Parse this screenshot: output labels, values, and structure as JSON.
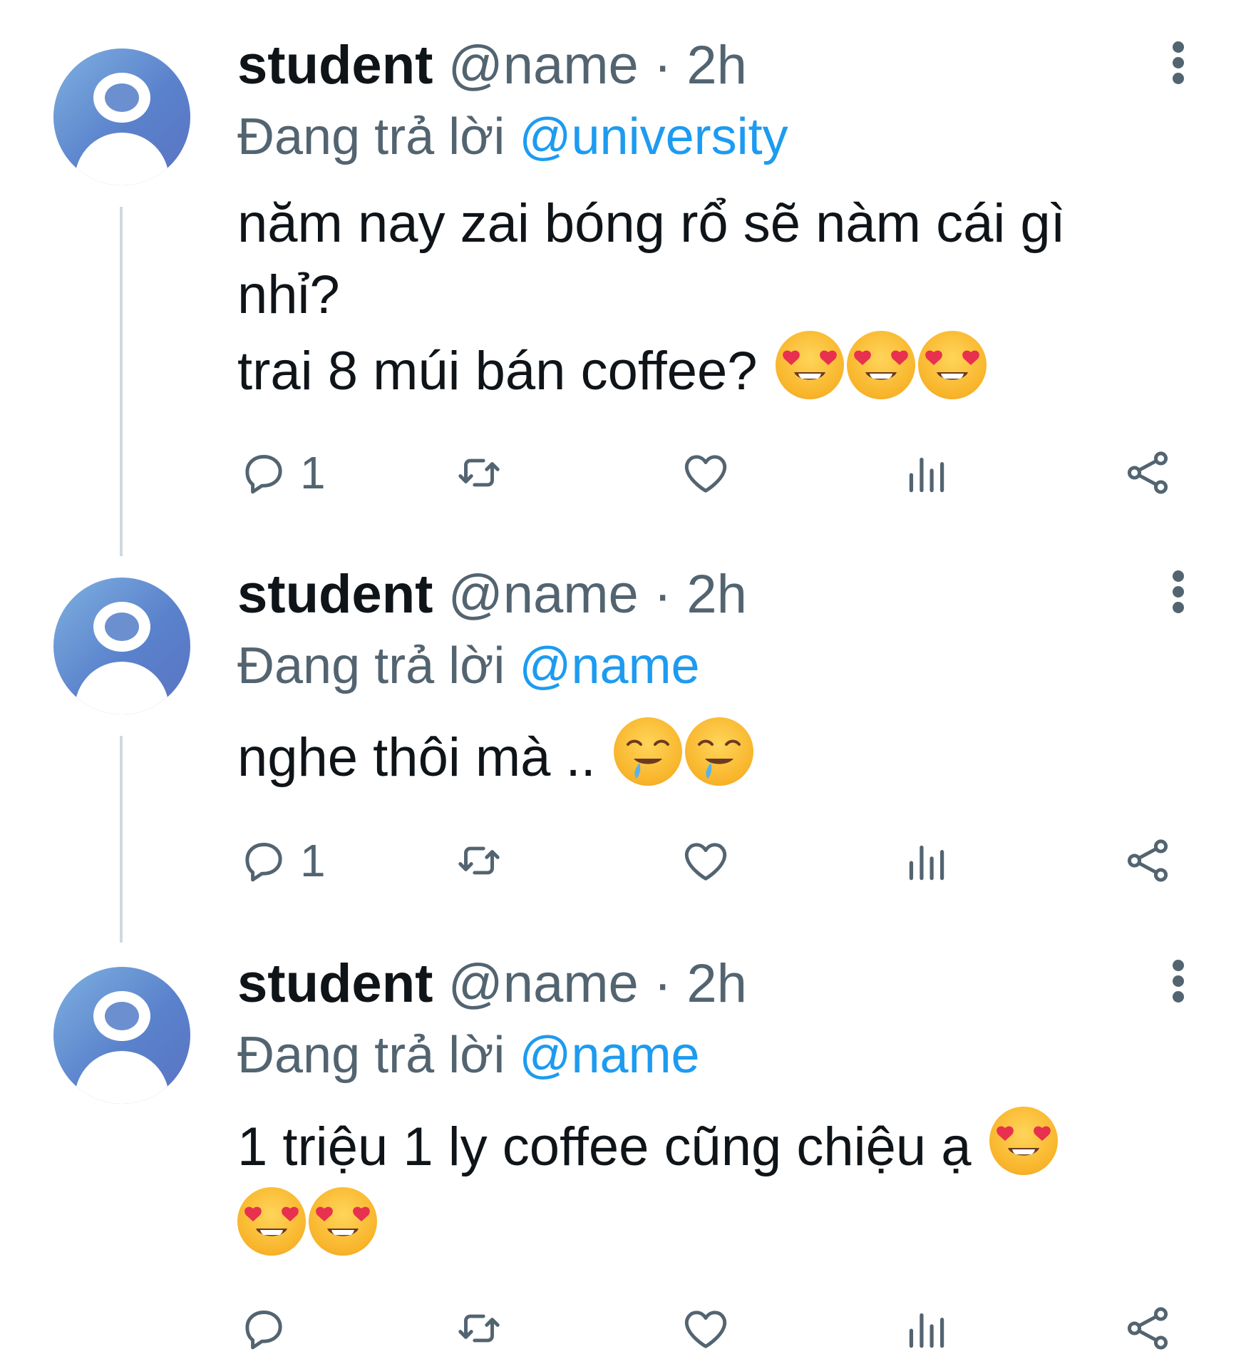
{
  "tweets": [
    {
      "display_name": "student",
      "handle": "@name",
      "separator": "·",
      "time": "2h",
      "reply_prefix": "Đang trả lời",
      "reply_to": "@university",
      "text_lines": [
        "năm nay zai bóng rổ sẽ nàm cái gì",
        "nhỉ?",
        "trai 8 múi bán coffee?"
      ],
      "trailing_emojis": [
        "heart-eyes",
        "heart-eyes",
        "heart-eyes"
      ],
      "reply_count": "1"
    },
    {
      "display_name": "student",
      "handle": "@name",
      "separator": "·",
      "time": "2h",
      "reply_prefix": "Đang trả lời",
      "reply_to": "@name",
      "text_lines": [
        "nghe thôi mà .."
      ],
      "trailing_emojis": [
        "drooling",
        "drooling"
      ],
      "reply_count": "1"
    },
    {
      "display_name": "student",
      "handle": "@name",
      "separator": "·",
      "time": "2h",
      "reply_prefix": "Đang trả lời",
      "reply_to": "@name",
      "text_lines": [
        "1 triệu 1 ly coffee cũng chiệu ạ"
      ],
      "trailing_emojis": [
        "heart-eyes",
        "heart-eyes",
        "heart-eyes"
      ],
      "reply_count": ""
    }
  ],
  "actions": [
    "reply",
    "retweet",
    "like",
    "views",
    "share"
  ],
  "colors": {
    "text": "#0f1419",
    "secondary": "#536471",
    "mention": "#1d9bf0",
    "thread_line": "#cfd9de"
  }
}
